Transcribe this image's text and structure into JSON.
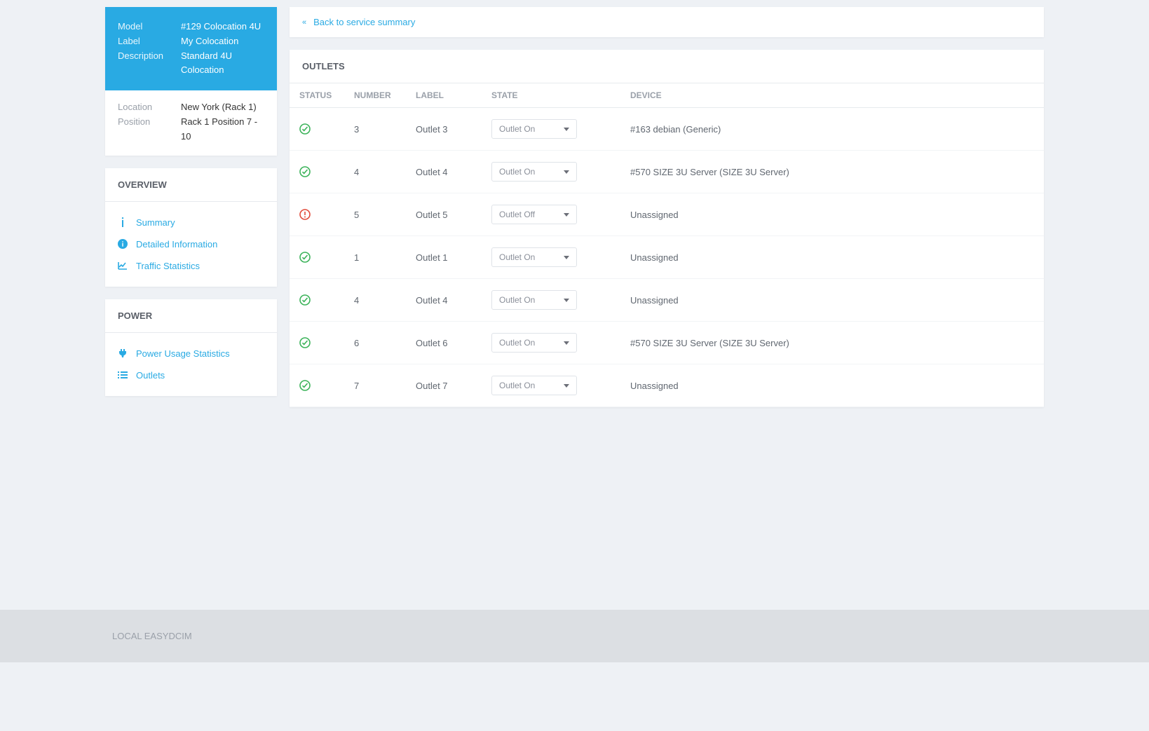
{
  "header": {
    "back_label": "Back to service summary",
    "model_label": "Model",
    "model_value": "#129 Colocation 4U",
    "label_label": "Label",
    "label_value": "My Colocation",
    "description_label": "Description",
    "description_value": "Standard 4U Colocation",
    "location_label": "Location",
    "location_value": "New York (Rack 1)",
    "position_label": "Position",
    "position_value": "Rack 1 Position 7 - 10"
  },
  "overview": {
    "title": "OVERVIEW",
    "summary": "Summary",
    "detailed": "Detailed Information",
    "traffic": "Traffic Statistics"
  },
  "power": {
    "title": "POWER",
    "usage": "Power Usage Statistics",
    "outlets": "Outlets"
  },
  "outlets": {
    "title": "OUTLETS",
    "columns": {
      "status": "STATUS",
      "number": "NUMBER",
      "label": "LABEL",
      "state": "STATE",
      "device": "DEVICE"
    },
    "rows": [
      {
        "status": "ok",
        "number": "3",
        "label": "Outlet 3",
        "state": "Outlet On",
        "device": "#163 debian (Generic)"
      },
      {
        "status": "ok",
        "number": "4",
        "label": "Outlet 4",
        "state": "Outlet On",
        "device": "#570 SIZE 3U Server (SIZE 3U Server)"
      },
      {
        "status": "err",
        "number": "5",
        "label": "Outlet 5",
        "state": "Outlet Off",
        "device": "Unassigned"
      },
      {
        "status": "ok",
        "number": "1",
        "label": "Outlet 1",
        "state": "Outlet On",
        "device": "Unassigned"
      },
      {
        "status": "ok",
        "number": "4",
        "label": "Outlet 4",
        "state": "Outlet On",
        "device": "Unassigned"
      },
      {
        "status": "ok",
        "number": "6",
        "label": "Outlet 6",
        "state": "Outlet On",
        "device": "#570 SIZE 3U Server (SIZE 3U Server)"
      },
      {
        "status": "ok",
        "number": "7",
        "label": "Outlet 7",
        "state": "Outlet On",
        "device": "Unassigned"
      }
    ]
  },
  "footer": {
    "text": "LOCAL EASYDCIM"
  }
}
